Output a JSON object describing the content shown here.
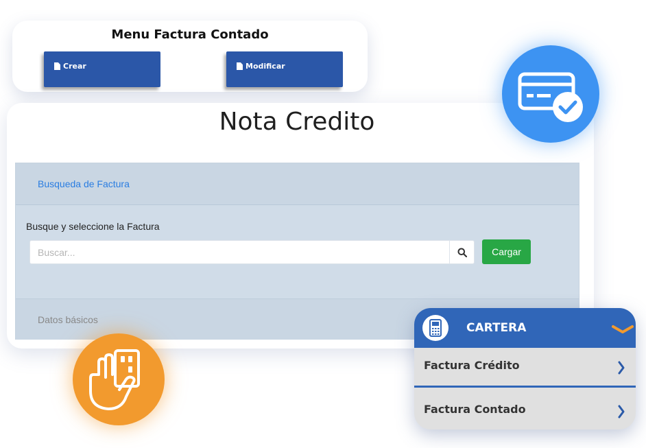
{
  "menu": {
    "title": "Menu Factura Contado",
    "crear_label": "Crear",
    "modificar_label": "Modificar",
    "button_color": "#2b57a8"
  },
  "nota": {
    "title": "Nota Credito",
    "panel_header": "Busqueda de Factura",
    "search_label": "Busque y seleccione la Factura",
    "search_placeholder": "Buscar...",
    "search_icon": "search-icon",
    "cargar_label": "Cargar",
    "cargar_color": "#28a745",
    "footer_section": "Datos básicos"
  },
  "badges": {
    "credit_card_icon": "credit-card-check-icon",
    "credit_card_color": "#3d93f2",
    "hand_icon": "hand-card-icon",
    "hand_color": "#f29a2e"
  },
  "cartera": {
    "title": "CARTERA",
    "header_color": "#3066b8",
    "items": [
      {
        "label": "Factura Crédito",
        "icon": "chevron-right-icon"
      },
      {
        "label": "Factura Contado",
        "icon": "chevron-right-icon"
      }
    ],
    "header_icon": "pos-terminal-icon",
    "toggle_icon": "chevron-down-icon"
  }
}
